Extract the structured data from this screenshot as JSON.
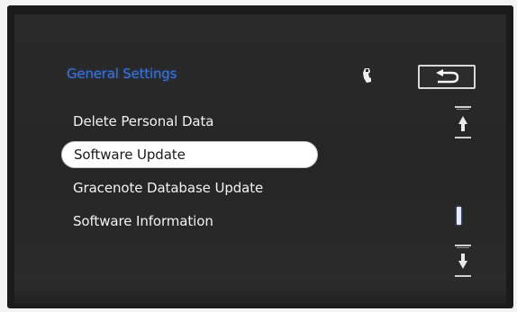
{
  "header": {
    "title": "General Settings"
  },
  "menu": {
    "items": [
      {
        "label": "Delete Personal Data",
        "selected": false
      },
      {
        "label": "Software Update",
        "selected": true
      },
      {
        "label": "Gracenote Database Update",
        "selected": false
      },
      {
        "label": "Software Information",
        "selected": false
      }
    ]
  },
  "icons": {
    "device": "phone-handset-icon",
    "back": "back-arrow-icon",
    "scroll_up": "page-up-arrow-icon",
    "scroll_down": "page-down-arrow-icon"
  },
  "scroll": {
    "position": "top"
  },
  "colors": {
    "title": "#3d73d6",
    "screen_background": "#262626",
    "selection": "#ffffff",
    "menu_text": "#f2f2f2"
  }
}
